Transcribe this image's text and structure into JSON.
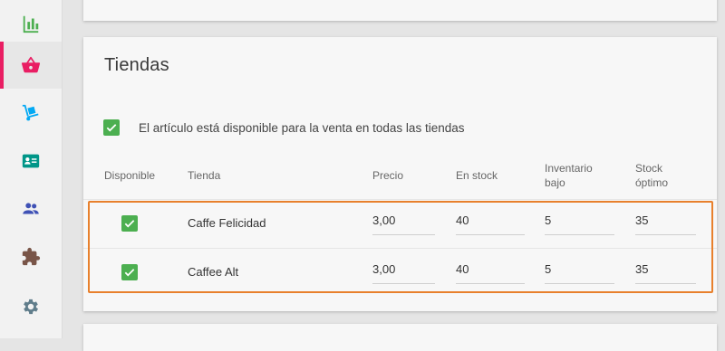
{
  "sidebar": {
    "items": [
      {
        "name": "reports",
        "icon": "bar-chart-icon",
        "color": "#4caf50"
      },
      {
        "name": "items",
        "icon": "basket-icon",
        "color": "#e91e63",
        "active": true
      },
      {
        "name": "inventory",
        "icon": "dolly-icon",
        "color": "#03a9f4"
      },
      {
        "name": "employees",
        "icon": "id-card-icon",
        "color": "#009688"
      },
      {
        "name": "customers",
        "icon": "people-icon",
        "color": "#3f51b5"
      },
      {
        "name": "integrations",
        "icon": "puzzle-icon",
        "color": "#795548"
      },
      {
        "name": "settings",
        "icon": "gear-icon",
        "color": "#607d8b"
      }
    ]
  },
  "stores_section": {
    "title": "Tiendas",
    "available_all_label": "El artículo está disponible para la venta en todas las tiendas",
    "available_all_checked": true,
    "columns": {
      "available": "Disponible",
      "store": "Tienda",
      "price": "Precio",
      "in_stock": "En stock",
      "low_stock": "Inventario bajo",
      "optimal_stock": "Stock óptimo"
    },
    "rows": [
      {
        "available": true,
        "store": "Caffe Felicidad",
        "price": "3,00",
        "in_stock": "40",
        "low_stock": "5",
        "optimal_stock": "35"
      },
      {
        "available": true,
        "store": "Caffee Alt",
        "price": "3,00",
        "in_stock": "40",
        "low_stock": "5",
        "optimal_stock": "35"
      }
    ]
  },
  "colors": {
    "accent": "#e91e63",
    "checkbox": "#4caf50",
    "highlight": "#e8802c"
  }
}
